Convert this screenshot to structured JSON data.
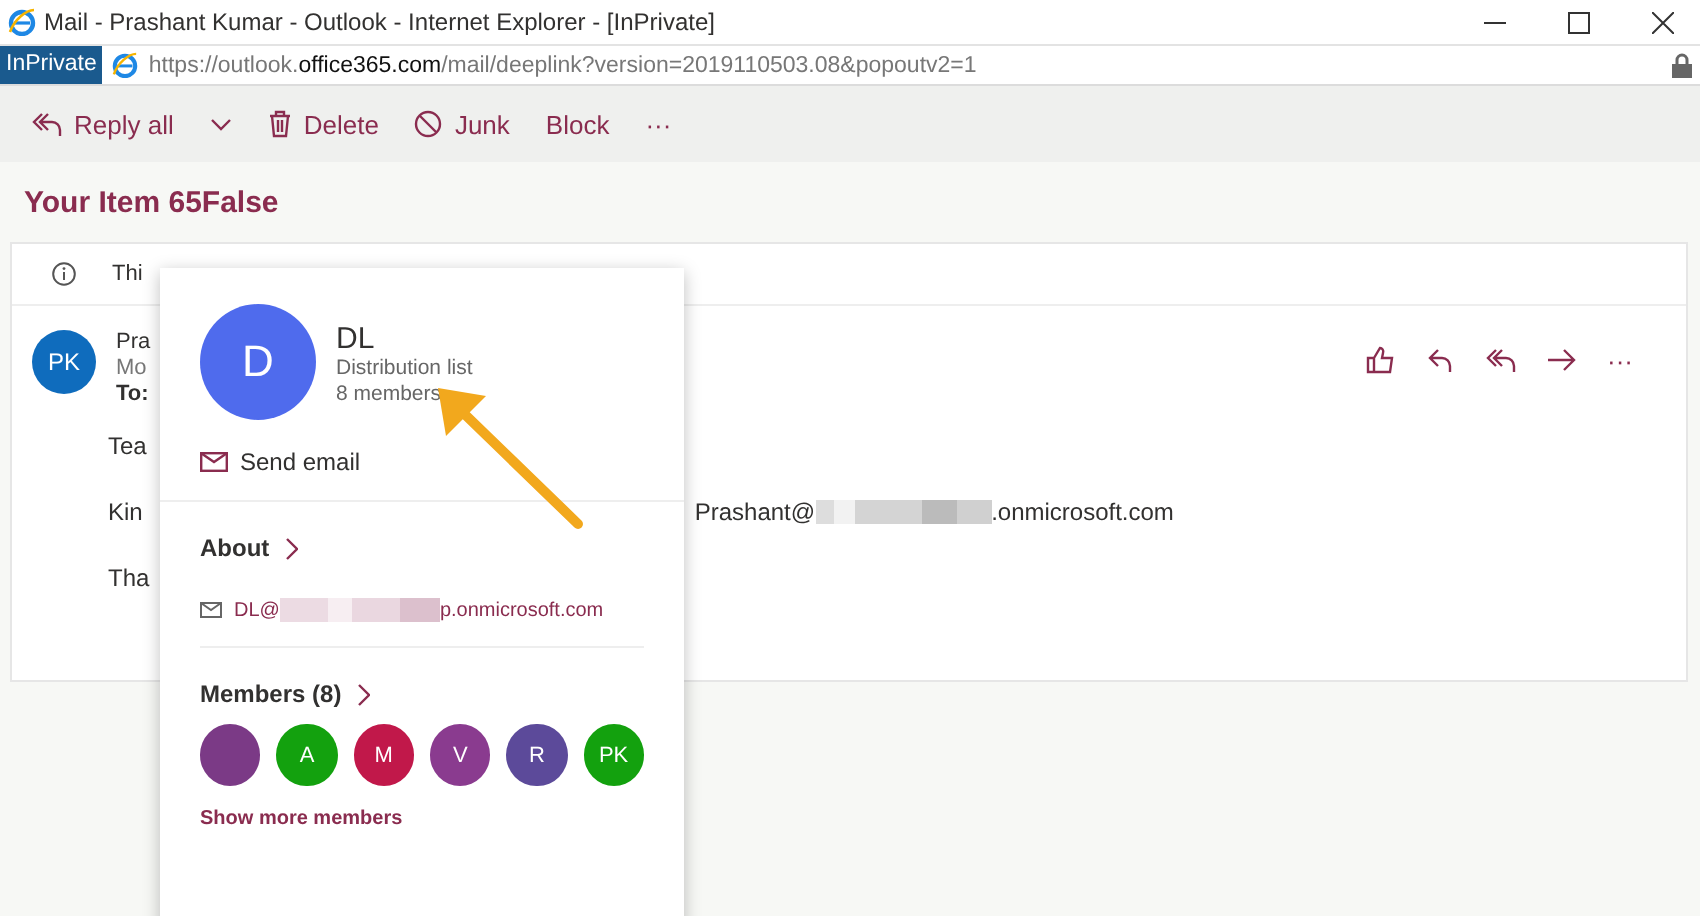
{
  "window": {
    "title": "Mail - Prashant Kumar - Outlook - Internet Explorer - [InPrivate]"
  },
  "address_bar": {
    "badge": "InPrivate",
    "url": "https://outlook.**office365.com**/mail/deeplink?version=2019110503.08&popoutv2=1"
  },
  "toolbar": [
    {
      "kind": "replyall",
      "label": "Reply all"
    },
    {
      "kind": "chevron"
    },
    {
      "kind": "delete",
      "label": "Delete"
    },
    {
      "kind": "junk",
      "label": "Junk"
    },
    {
      "kind": "plain",
      "label": "Block"
    },
    {
      "kind": "more",
      "label": "···"
    }
  ],
  "subject": "Your Item 65False",
  "message": {
    "info_text": "Thi",
    "avatar": "PK",
    "sender": "Pra",
    "date": "Mo",
    "to_label": "To:",
    "actions": [
      {
        "kind": "like"
      },
      {
        "kind": "reply"
      },
      {
        "kind": "replyall"
      },
      {
        "kind": "forward"
      },
      {
        "kind": "more",
        "label": "···"
      }
    ],
    "body": [
      {
        "text": "Tea"
      },
      {
        "text": "Kin",
        "email_start": "Prashant@",
        "email_end": ".onmicrosoft.com"
      },
      {
        "text": "Tha"
      }
    ]
  },
  "contact_card": {
    "avatar": "D",
    "name": "DL",
    "type": "Distribution list",
    "members_count": "8 members",
    "send_email": "Send email",
    "about_heading": "About",
    "email_start": "DL@",
    "email_end": "p.onmicrosoft.com",
    "members_heading": "Members (8)",
    "members": [
      {
        "color": "#7b3a86"
      },
      {
        "initials": "A",
        "color": "#13a10e"
      },
      {
        "initials": "M",
        "color": "#c1184a"
      },
      {
        "initials": "V",
        "color": "#8a3b8f"
      },
      {
        "initials": "R",
        "color": "#5c4a9a"
      },
      {
        "initials": "PK",
        "color": "#13a10e"
      }
    ],
    "show_more": "Show more members"
  }
}
